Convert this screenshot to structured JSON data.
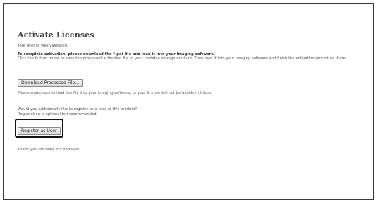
{
  "page": {
    "title": "Activate Licenses",
    "validated_text": "Your license was validated.",
    "instruction_bold": "To complete activation, please download the *.paf file and load it into your imaging software.",
    "instruction_text": "Click the button below to save the processed activation file to your portable storage medium. Then load it into your imaging software and finish the activation procedure there.",
    "download_button_label": "Download Processed File...",
    "warning_text": "Please make sure to load the file into your imaging software, or your license will not be usable in future.",
    "register_question": "Would you additionally like to register as a user of this product?",
    "register_note": "Registration is optional but recommended.",
    "register_button_label": "Register as User",
    "thank_you_text": "Thank you for using our software."
  },
  "colors": {
    "frame_border": "#3a3a3a",
    "title_text": "#444444",
    "body_text": "#555555",
    "button_border": "#8a8a8a",
    "highlight_border": "#111111"
  }
}
